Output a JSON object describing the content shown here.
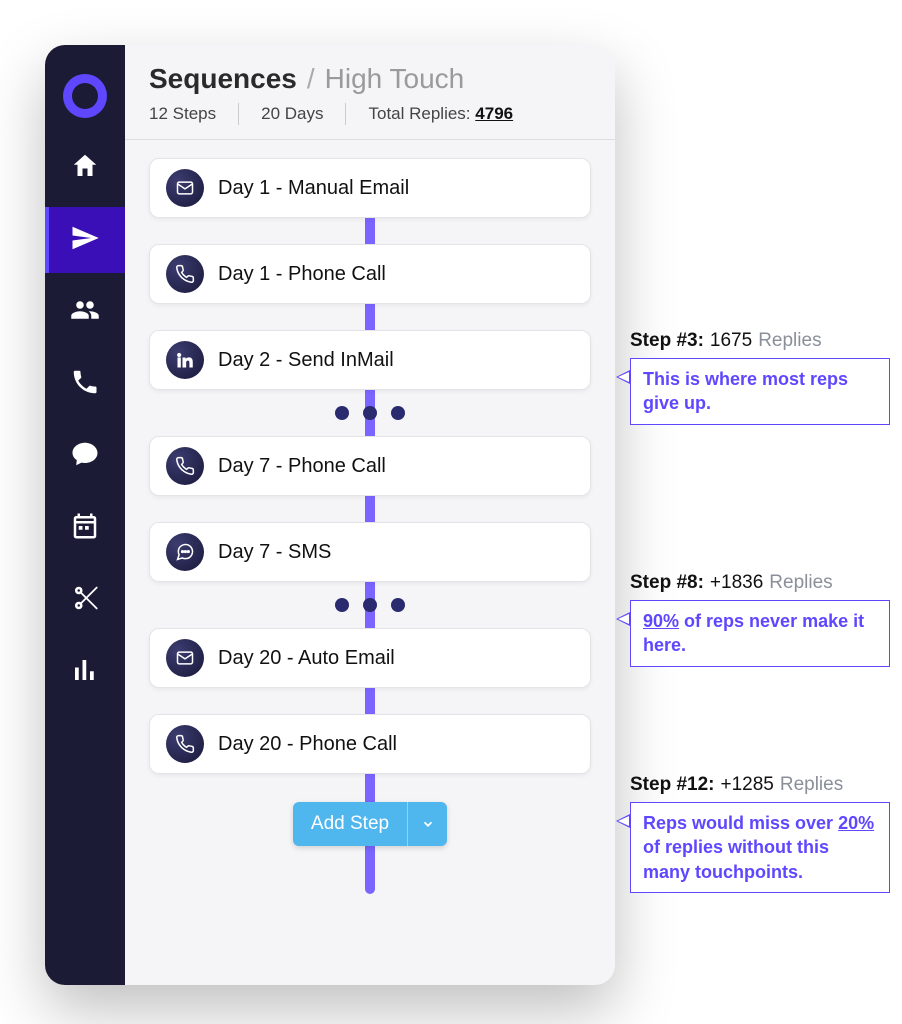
{
  "breadcrumb": {
    "section": "Sequences",
    "separator": "/",
    "current": "High Touch"
  },
  "stats": {
    "steps_label": "12 Steps",
    "days_label": "20 Days",
    "total_replies_prefix": "Total Replies:",
    "total_replies_count": "4796"
  },
  "steps": [
    {
      "icon": "email-icon",
      "label": "Day 1 - Manual Email"
    },
    {
      "icon": "phone-icon",
      "label": "Day 1 - Phone Call"
    },
    {
      "icon": "linkedin-icon",
      "label": "Day 2 - Send InMail"
    },
    {
      "icon": "phone-icon",
      "label": "Day 7 - Phone Call"
    },
    {
      "icon": "sms-icon",
      "label": "Day 7 - SMS"
    },
    {
      "icon": "email-icon",
      "label": "Day 20 - Auto Email"
    },
    {
      "icon": "phone-icon",
      "label": "Day 20 - Phone Call"
    }
  ],
  "add_step_label": "Add Step",
  "annotations": [
    {
      "step_label": "Step #3:",
      "value": "1675",
      "suffix": "Replies",
      "text_before": "This is where most reps give up.",
      "emph": "",
      "text_after": ""
    },
    {
      "step_label": "Step #8:",
      "value": "+1836",
      "suffix": "Replies",
      "text_before": "",
      "emph": "90%",
      "text_after": " of reps never make it here."
    },
    {
      "step_label": "Step #12:",
      "value": "+1285",
      "suffix": "Replies",
      "text_before": "Reps would miss over ",
      "emph": "20%",
      "text_after": " of replies without this many touchpoints."
    }
  ],
  "sidebar_icons": [
    "logo-icon",
    "home-icon",
    "send-icon",
    "people-icon",
    "phone-icon",
    "chat-icon",
    "calendar-icon",
    "scissors-icon",
    "chart-icon"
  ]
}
